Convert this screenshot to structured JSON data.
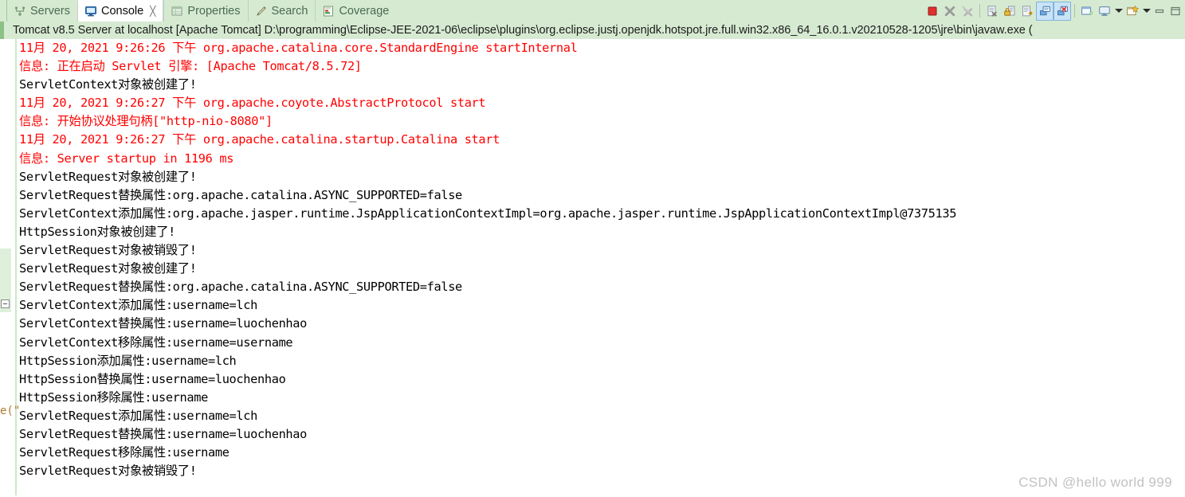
{
  "window": {
    "tabs": [
      {
        "label": "Servers",
        "icon": "servers-icon",
        "active": false,
        "closable": false
      },
      {
        "label": "Console",
        "icon": "console-icon",
        "active": true,
        "closable": true,
        "close_glyph": "╳"
      },
      {
        "label": "Properties",
        "icon": "properties-icon",
        "active": false,
        "closable": false
      },
      {
        "label": "Search",
        "icon": "search-icon",
        "active": false,
        "closable": false
      },
      {
        "label": "Coverage",
        "icon": "coverage-icon",
        "active": false,
        "closable": false
      }
    ],
    "toolbar": [
      {
        "name": "terminate-button",
        "type": "icon"
      },
      {
        "name": "remove-launch-button",
        "type": "icon"
      },
      {
        "name": "remove-all-terminated-button",
        "type": "icon"
      },
      {
        "name": "separator-1",
        "type": "separator"
      },
      {
        "name": "clear-console-button",
        "type": "icon"
      },
      {
        "name": "scroll-lock-button",
        "type": "icon"
      },
      {
        "name": "word-wrap-button",
        "type": "icon"
      },
      {
        "name": "show-console-on-output-button",
        "type": "icon",
        "toggled": true
      },
      {
        "name": "show-console-on-error-button",
        "type": "icon",
        "toggled": true
      },
      {
        "name": "separator-2",
        "type": "separator"
      },
      {
        "name": "open-console-button",
        "type": "icon"
      },
      {
        "name": "display-selected-console-button",
        "type": "icon"
      },
      {
        "name": "display-selected-console-dropdown",
        "type": "arrow"
      },
      {
        "name": "new-console-view-button",
        "type": "icon"
      },
      {
        "name": "view-menu-dropdown",
        "type": "arrow"
      },
      {
        "name": "minimize-view-button",
        "type": "window"
      },
      {
        "name": "maximize-view-button",
        "type": "window"
      }
    ],
    "process_title": "Tomcat v8.5 Server at localhost [Apache Tomcat] D:\\programming\\Eclipse-JEE-2021-06\\eclipse\\plugins\\org.eclipse.justj.openjdk.hotspot.jre.full.win32.x86_64_16.0.1.v20210528-1205\\jre\\bin\\javaw.exe ("
  },
  "console": {
    "lines": [
      {
        "text": "11月 20, 2021 9:26:26 下午 org.apache.catalina.core.StandardEngine startInternal",
        "stream": "err"
      },
      {
        "text": "信息: 正在启动 Servlet 引擎: [Apache Tomcat/8.5.72]",
        "stream": "err"
      },
      {
        "text": "ServletContext对象被创建了!",
        "stream": "out"
      },
      {
        "text": "11月 20, 2021 9:26:27 下午 org.apache.coyote.AbstractProtocol start",
        "stream": "err"
      },
      {
        "text": "信息: 开始协议处理句柄[\"http-nio-8080\"]",
        "stream": "err"
      },
      {
        "text": "11月 20, 2021 9:26:27 下午 org.apache.catalina.startup.Catalina start",
        "stream": "err"
      },
      {
        "text": "信息: Server startup in 1196 ms",
        "stream": "err"
      },
      {
        "text": "ServletRequest对象被创建了!",
        "stream": "out"
      },
      {
        "text": "ServletRequest替换属性:org.apache.catalina.ASYNC_SUPPORTED=false",
        "stream": "out"
      },
      {
        "text": "ServletContext添加属性:org.apache.jasper.runtime.JspApplicationContextImpl=org.apache.jasper.runtime.JspApplicationContextImpl@7375135",
        "stream": "out"
      },
      {
        "text": "HttpSession对象被创建了!",
        "stream": "out"
      },
      {
        "text": "ServletRequest对象被销毁了!",
        "stream": "out"
      },
      {
        "text": "ServletRequest对象被创建了!",
        "stream": "out"
      },
      {
        "text": "ServletRequest替换属性:org.apache.catalina.ASYNC_SUPPORTED=false",
        "stream": "out"
      },
      {
        "text": "ServletContext添加属性:username=lch",
        "stream": "out"
      },
      {
        "text": "ServletContext替换属性:username=luochenhao",
        "stream": "out"
      },
      {
        "text": "ServletContext移除属性:username=username",
        "stream": "out"
      },
      {
        "text": "HttpSession添加属性:username=lch",
        "stream": "out"
      },
      {
        "text": "HttpSession替换属性:username=luochenhao",
        "stream": "out"
      },
      {
        "text": "HttpSession移除属性:username",
        "stream": "out"
      },
      {
        "text": "ServletRequest添加属性:username=lch",
        "stream": "out"
      },
      {
        "text": "ServletRequest替换属性:username=luochenhao",
        "stream": "out"
      },
      {
        "text": "ServletRequest移除属性:username",
        "stream": "out"
      },
      {
        "text": "ServletRequest对象被销毁了!",
        "stream": "out"
      }
    ],
    "bleed_text": "e(\"",
    "colors": {
      "stderr": "#ff0000",
      "stdout": "#000000",
      "tab_bar": "#d6ead2",
      "active_tab": "#ffffff"
    }
  },
  "watermark": "CSDN @hello world 999"
}
